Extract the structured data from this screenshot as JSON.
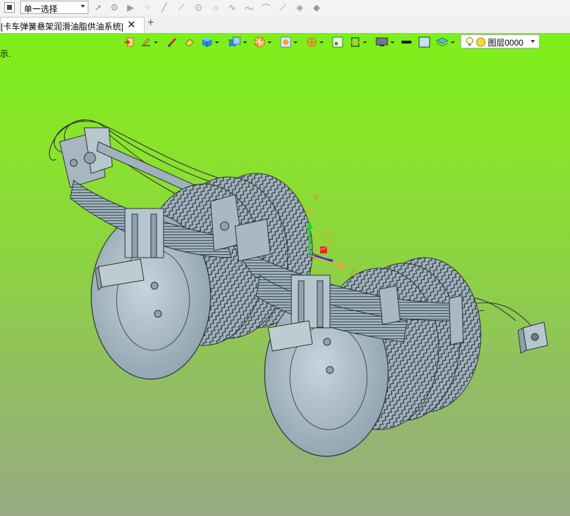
{
  "toolbar": {
    "select_mode": "单一选择",
    "icons": [
      "pointer-icon",
      "filter-icon",
      "play-icon",
      "points-icon",
      "line-icon",
      "segment-icon",
      "circle-icon",
      "ring-icon",
      "curve-icon",
      "wave-icon",
      "arc-icon",
      "tangent-icon",
      "surface-icon",
      "layers-3d-icon"
    ]
  },
  "tabs": {
    "doc_title": "[卡车弹簧悬架润滑油脂供油系统]",
    "close_symbol": "✕",
    "add_symbol": "+"
  },
  "viewport": {
    "hint_text": "示.",
    "layer_label": "图层0000",
    "axis_labels": {
      "y": "Y",
      "z": "Z"
    },
    "background_top": "#7cf01a",
    "background_bottom": "#98ab84"
  }
}
